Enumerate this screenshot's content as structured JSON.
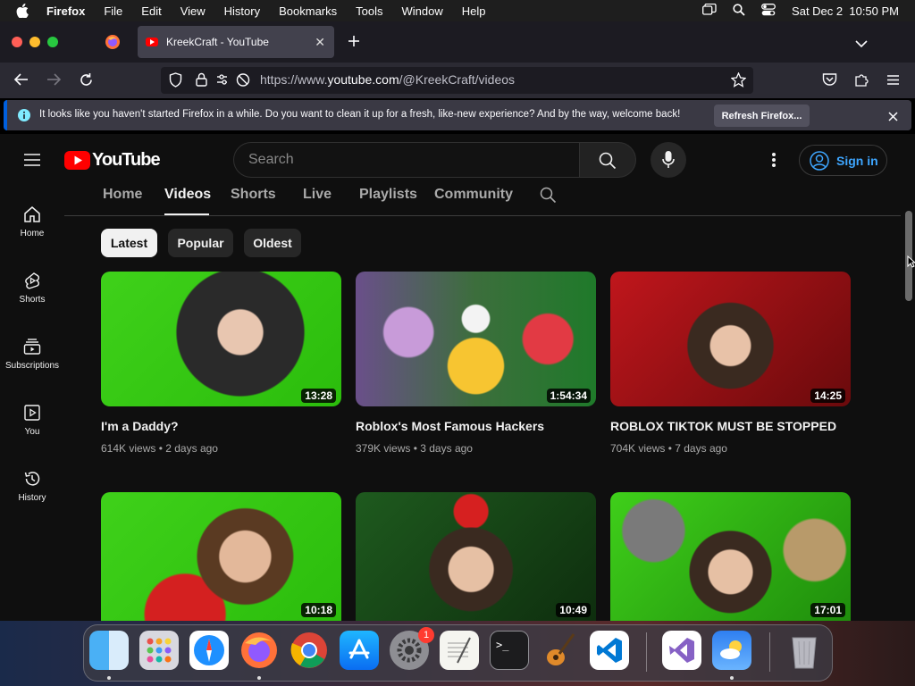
{
  "menubar": {
    "app_name": "Firefox",
    "items": [
      "File",
      "Edit",
      "View",
      "History",
      "Bookmarks",
      "Tools",
      "Window",
      "Help"
    ],
    "clock": "Sat Dec 2  10:50 PM"
  },
  "browser": {
    "active_tab_title": "KreekCraft - YouTube",
    "url_prefix": "https://www.",
    "url_domain": "youtube.com",
    "url_path": "/@KreekCraft/videos"
  },
  "notification": {
    "message": "It looks like you haven't started Firefox in a while. Do you want to clean it up for a fresh, like-new experience? And by the way, welcome back!",
    "button_label": "Refresh Firefox..."
  },
  "youtube": {
    "logo_text": "YouTube",
    "search_placeholder": "Search",
    "signin_label": "Sign in",
    "sidebar": [
      {
        "label": "Home",
        "icon": "home-icon"
      },
      {
        "label": "Shorts",
        "icon": "shorts-icon"
      },
      {
        "label": "Subscriptions",
        "icon": "subscriptions-icon"
      },
      {
        "label": "You",
        "icon": "you-icon"
      },
      {
        "label": "History",
        "icon": "history-icon"
      }
    ],
    "channel_tabs": [
      "Home",
      "Videos",
      "Shorts",
      "Live",
      "Playlists",
      "Community"
    ],
    "active_tab": "Videos",
    "chips": [
      "Latest",
      "Popular",
      "Oldest"
    ],
    "active_chip": "Latest",
    "videos": [
      {
        "title": "I'm a Daddy?",
        "views": "614K views",
        "age": "2 days ago",
        "duration": "13:28"
      },
      {
        "title": "Roblox's Most Famous Hackers",
        "views": "379K views",
        "age": "3 days ago",
        "duration": "1:54:34"
      },
      {
        "title": "ROBLOX TIKTOK MUST BE STOPPED",
        "views": "704K views",
        "age": "7 days ago",
        "duration": "14:25"
      },
      {
        "title": "",
        "views": "",
        "age": "",
        "duration": "10:18"
      },
      {
        "title": "",
        "views": "",
        "age": "",
        "duration": "10:49"
      },
      {
        "title": "",
        "views": "",
        "age": "",
        "duration": "17:01"
      }
    ]
  },
  "dock": {
    "apps": [
      "Finder",
      "Launchpad",
      "Safari",
      "Firefox",
      "Chrome",
      "App Store",
      "System Settings",
      "TextEdit",
      "Terminal",
      "GarageBand",
      "VS Code",
      "Visual Studio",
      "Weather",
      "Trash"
    ],
    "settings_badge": "1"
  }
}
